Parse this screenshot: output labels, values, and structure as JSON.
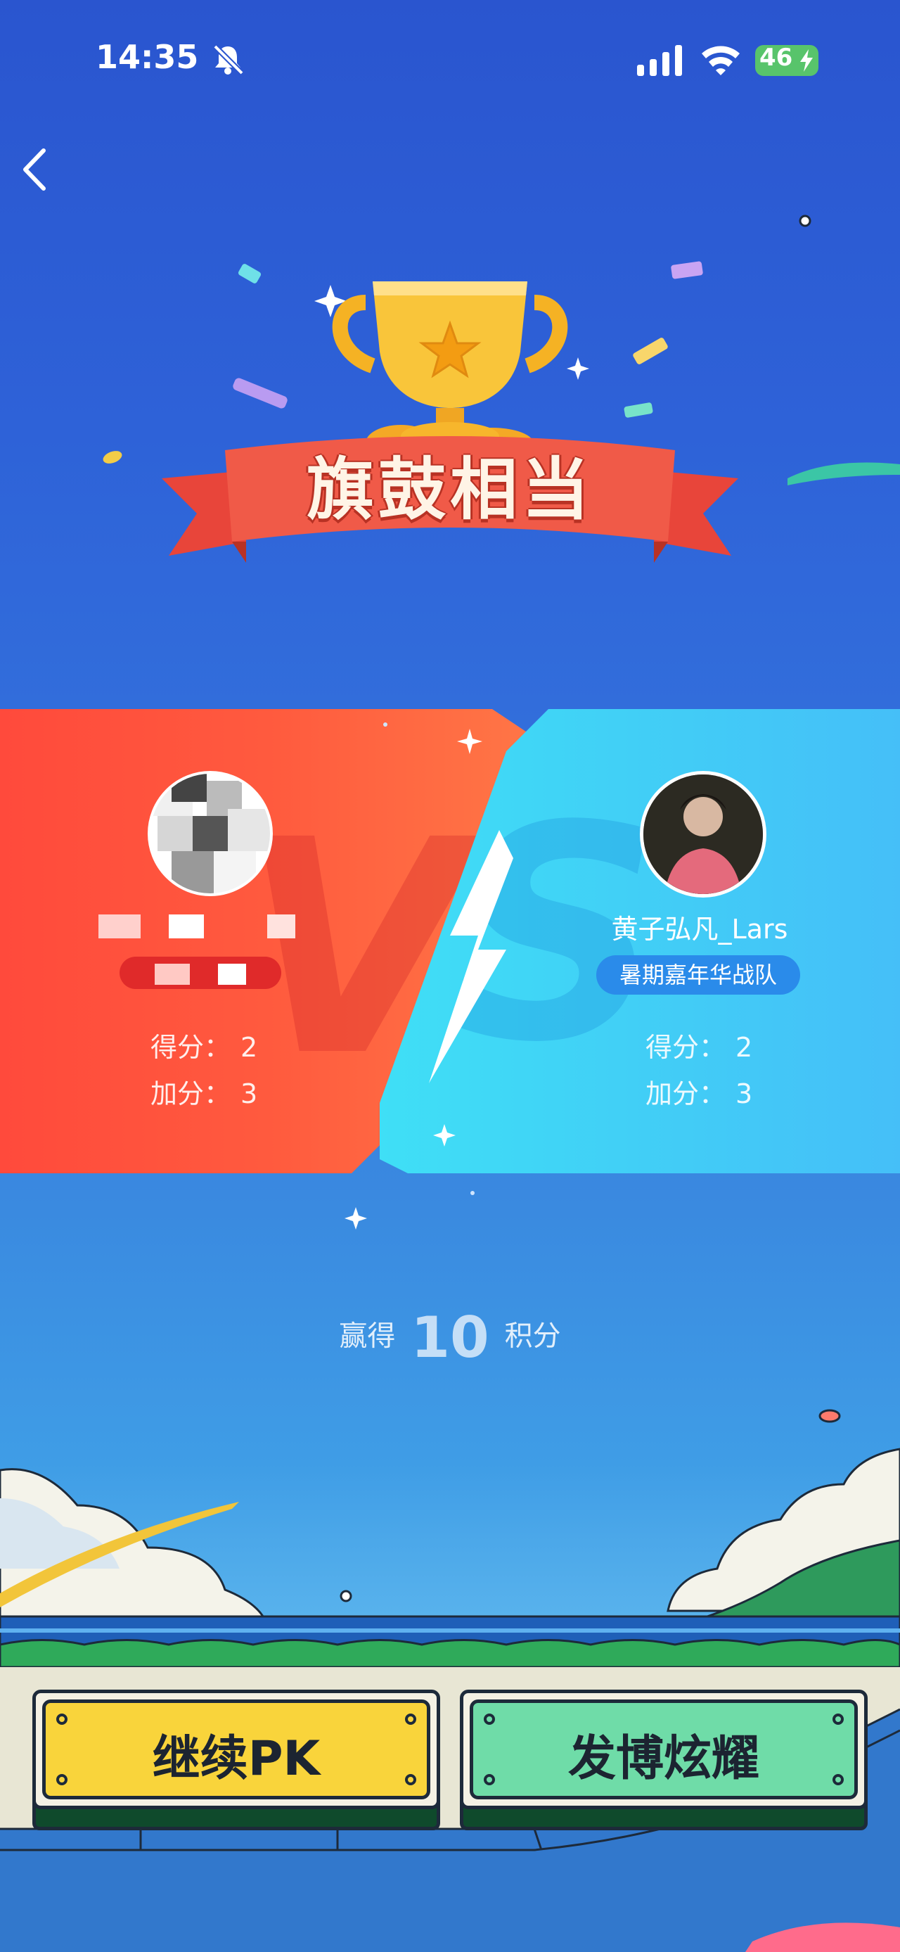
{
  "status_bar": {
    "time": "14:35",
    "battery": "46"
  },
  "result": {
    "title": "旗鼓相当"
  },
  "left_player": {
    "score_label": "得分：",
    "score": "2",
    "bonus_label": "加分：",
    "bonus": "3"
  },
  "right_player": {
    "name": "黄子弘凡_Lars",
    "team": "暑期嘉年华战队",
    "score_label": "得分：",
    "score": "2",
    "bonus_label": "加分：",
    "bonus": "3"
  },
  "reward": {
    "prefix": "赢得",
    "points": "10",
    "suffix": "积分"
  },
  "buttons": {
    "continue": "继续PK",
    "share": "发博炫耀"
  },
  "colors": {
    "continue_button": "#f9d43b",
    "share_button": "#6fdca8",
    "left_card": "#ff5a3e",
    "right_card": "#41cff6"
  },
  "icons": [
    "bell-off-icon",
    "signal-icon",
    "wifi-icon",
    "battery-icon",
    "back-chevron-icon",
    "trophy-icon",
    "lightning-bolt-icon"
  ]
}
